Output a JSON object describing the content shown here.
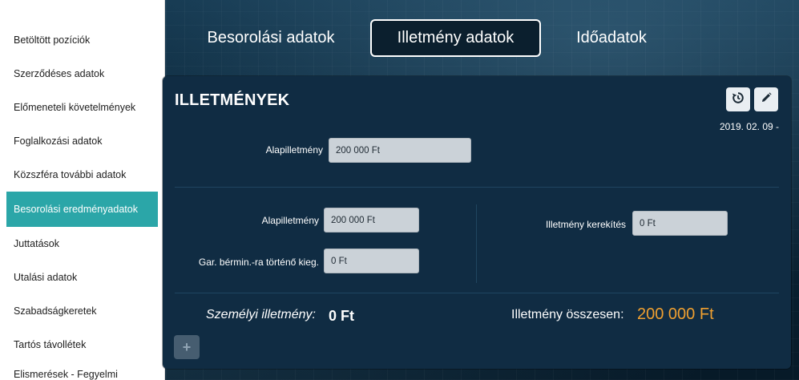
{
  "sidebar": {
    "items": [
      {
        "label": "Betöltött pozíciók"
      },
      {
        "label": "Szerződéses adatok"
      },
      {
        "label": "Előmeneteli követelmények"
      },
      {
        "label": "Foglalkozási adatok"
      },
      {
        "label": "Közszféra további adatok"
      },
      {
        "label": "Besorolási eredményadatok",
        "active": true
      },
      {
        "label": "Juttatások"
      },
      {
        "label": "Utalási adatok"
      },
      {
        "label": "Szabadságkeretek"
      },
      {
        "label": "Tartós távollétek"
      },
      {
        "label": "Elismerések - Fegyelmi"
      }
    ]
  },
  "tabs": [
    {
      "label": "Besorolási adatok"
    },
    {
      "label": "Illetmény adatok",
      "active": true
    },
    {
      "label": "Időadatok"
    }
  ],
  "panel": {
    "title": "ILLETMÉNYEK",
    "date": "2019. 02. 09 -",
    "icons": {
      "history": "history-icon",
      "edit": "pencil-icon"
    },
    "top_field": {
      "label": "Alapilletmény",
      "value": "200 000 Ft"
    },
    "left_fields": [
      {
        "label": "Alapilletmény",
        "value": "200 000 Ft"
      },
      {
        "label": "Gar. bérmin.-ra történő kieg.",
        "value": "0 Ft"
      }
    ],
    "right_field": {
      "label": "Illetmény kerekítés",
      "value": "0 Ft"
    },
    "personal": {
      "label": "Személyi illetmény:",
      "value": "0 Ft"
    },
    "total": {
      "label": "Illetmény összesen:",
      "value": "200 000 Ft"
    },
    "add_label": "+"
  },
  "colors": {
    "accent": "#2ba6a8",
    "total": "#f0a030",
    "panel": "#102c43"
  }
}
